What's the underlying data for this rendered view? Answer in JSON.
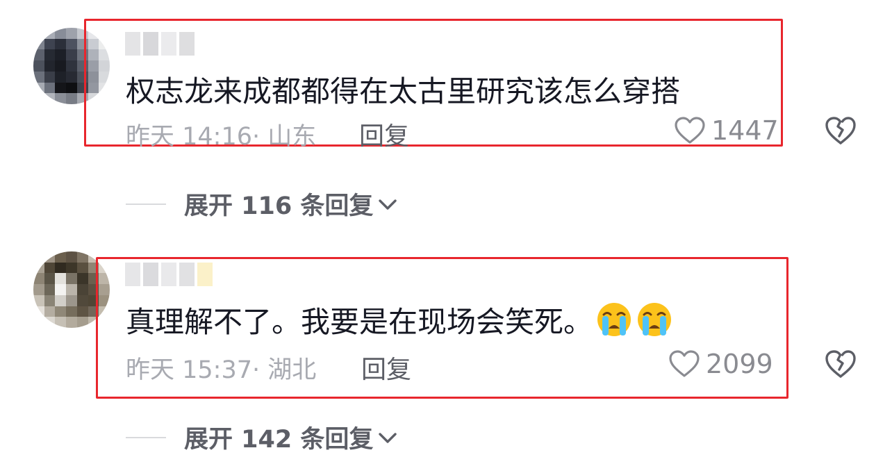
{
  "comments": [
    {
      "text": "权志龙来成都都得在太古里研究该怎么穿搭",
      "meta": "昨天 14:16· 山东",
      "reply_label": "回复",
      "likes": "1447",
      "expand_label": "展开 116 条回复"
    },
    {
      "text": "真理解不了。我要是在现场会笑死。",
      "meta": "昨天 15:37· 湖北",
      "reply_label": "回复",
      "likes": "2099",
      "expand_label": "展开 142 条回复"
    }
  ],
  "colors": {
    "highlight": "#e8262d",
    "text": "#161823",
    "muted": "#a8aab1"
  },
  "icons": [
    "heart-outline-icon",
    "broken-heart-icon",
    "chevron-down-icon",
    "crying-emoji-icon"
  ]
}
